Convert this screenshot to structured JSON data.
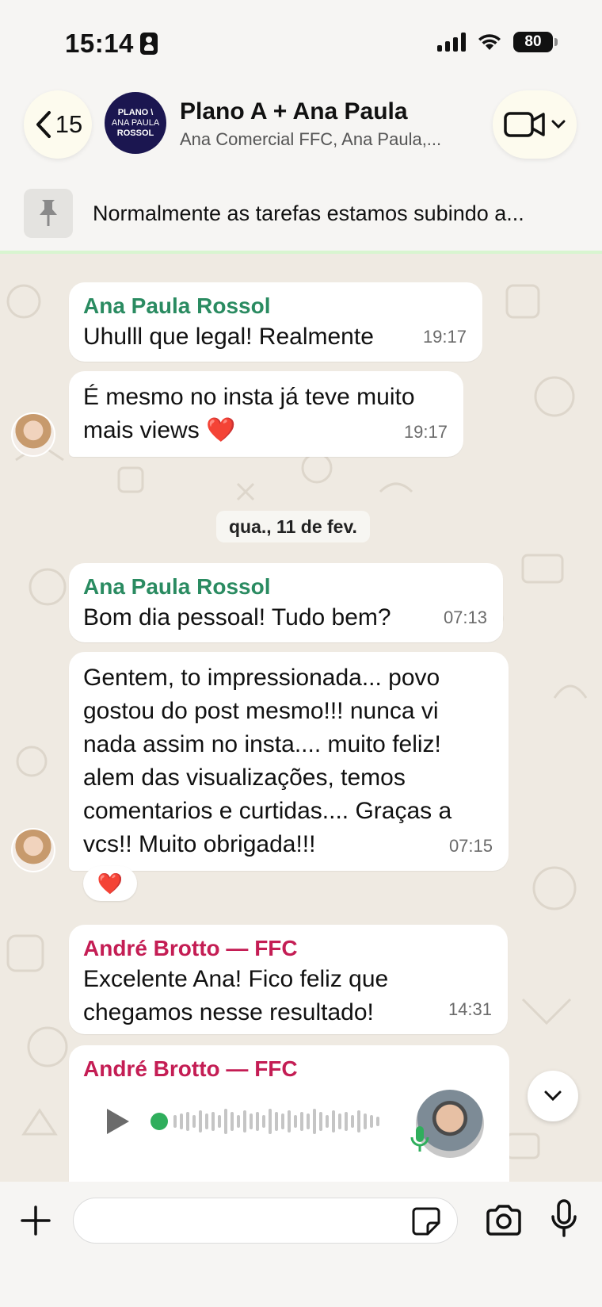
{
  "status_bar": {
    "time": "15:14",
    "battery": "80"
  },
  "header": {
    "back_count": "15",
    "avatar_lines": [
      "PLANO \\",
      "ANA PAULA",
      "ROSSOL"
    ],
    "title": "Plano A + Ana Paula",
    "subtitle": "Ana Comercial FFC, Ana Paula,..."
  },
  "pinned": {
    "text": "Normalmente as tarefas estamos subindo a..."
  },
  "messages": [
    {
      "sender": "Ana Paula Rossol",
      "text": "Uhulll que legal! Realmente",
      "time": "19:17"
    },
    {
      "text_lines": [
        "É mesmo no insta já teve muito",
        "mais views ❤️"
      ],
      "time": "19:17"
    },
    {
      "date": "qua., 11 de fev."
    },
    {
      "sender": "Ana Paula Rossol",
      "text": "Bom dia pessoal! Tudo bem?",
      "time": "07:13"
    },
    {
      "text_lines": [
        "Gentem, to impressionada... povo",
        "gostou do post mesmo!!! nunca vi",
        "nada assim no insta.... muito feliz!",
        "alem das visualizações, temos",
        "comentarios e curtidas.... Graças a",
        "vcs!! Muito obrigada!!!"
      ],
      "time": "07:15",
      "reaction": "❤️"
    },
    {
      "sender": "André Brotto — FFC",
      "text_lines": [
        "Excelente Ana! Fico feliz que",
        "chegamos nesse resultado!"
      ],
      "time": "14:31"
    },
    {
      "sender": "André Brotto — FFC",
      "type": "voice"
    }
  ],
  "composer": {
    "placeholder": ""
  },
  "colors": {
    "green_sender": "#2a8b61",
    "red_sender": "#c41d54",
    "background": "#efeae2"
  },
  "icons": [
    "back-chevron-icon",
    "video-camera-icon",
    "chevron-down-icon",
    "pin-icon",
    "play-icon",
    "mic-icon",
    "plus-icon",
    "sticker-icon",
    "camera-icon"
  ]
}
